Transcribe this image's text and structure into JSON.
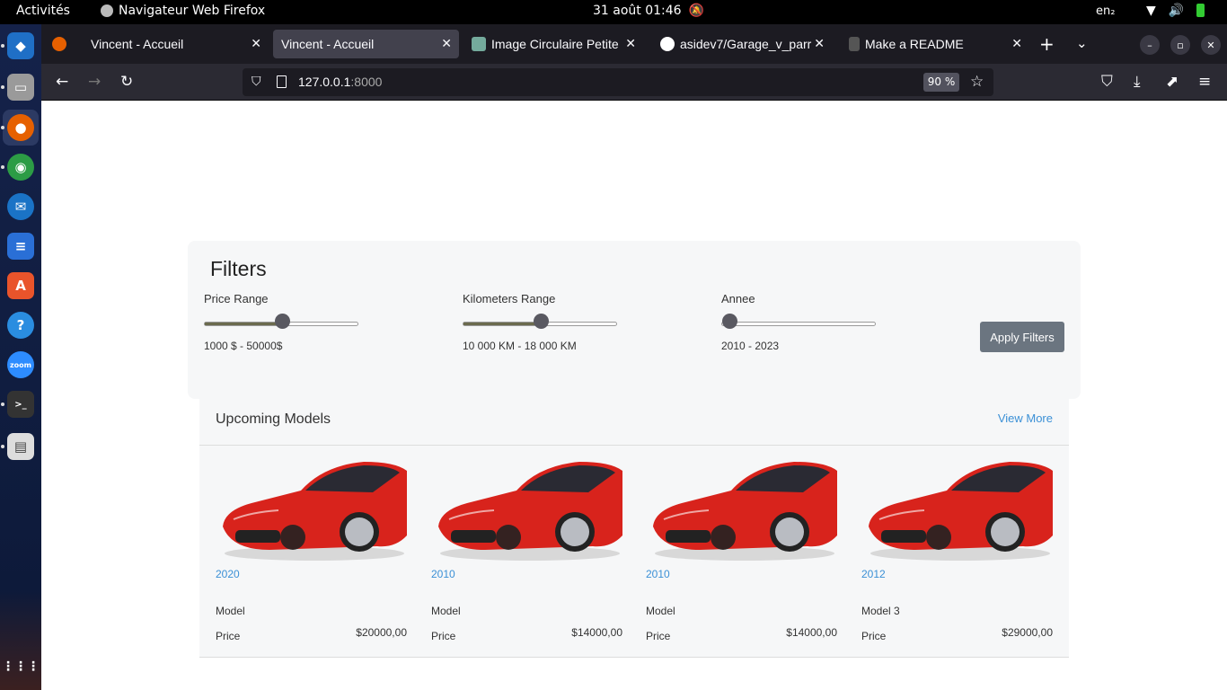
{
  "topbar": {
    "activities": "Activités",
    "app_name": "Navigateur Web Firefox",
    "clock": "31 août  01:46",
    "lang": "en₂"
  },
  "tabs": [
    {
      "title": "Vincent - Accueil",
      "active": false
    },
    {
      "title": "Vincent - Accueil",
      "active": true
    },
    {
      "title": "Image Circulaire Petite",
      "active": false
    },
    {
      "title": "asidev7/Garage_v_parr",
      "active": false
    },
    {
      "title": "Make a README",
      "active": false
    }
  ],
  "url": {
    "host": "127.0.0.1",
    "port": ":8000",
    "zoom": "90 %"
  },
  "filters": {
    "title": "Filters",
    "price": {
      "label": "Price Range",
      "value": "1000 $ - 50000$",
      "level": 0.5
    },
    "km": {
      "label": "Kilometers Range",
      "value": "10 000 KM - 18 000 KM",
      "level": 0.5
    },
    "year": {
      "label": "Annee",
      "value": "2010 - 2023",
      "level": 0.0
    },
    "apply": "Apply Filters"
  },
  "upcoming": {
    "title": "Upcoming Models",
    "view_more": "View More",
    "cars": [
      {
        "year": "2020",
        "model": "Model",
        "price_label": "Price",
        "price": "$20000,00"
      },
      {
        "year": "2010",
        "model": "Model",
        "price_label": "Price",
        "price": "$14000,00"
      },
      {
        "year": "2010",
        "model": "Model",
        "price_label": "Price",
        "price": "$14000,00"
      },
      {
        "year": "2012",
        "model": "Model 3",
        "price_label": "Price",
        "price": "$29000,00"
      }
    ]
  },
  "colors": {
    "accent_link": "#3b90d6",
    "car_red": "#d8231c",
    "button": "#6b7580"
  }
}
